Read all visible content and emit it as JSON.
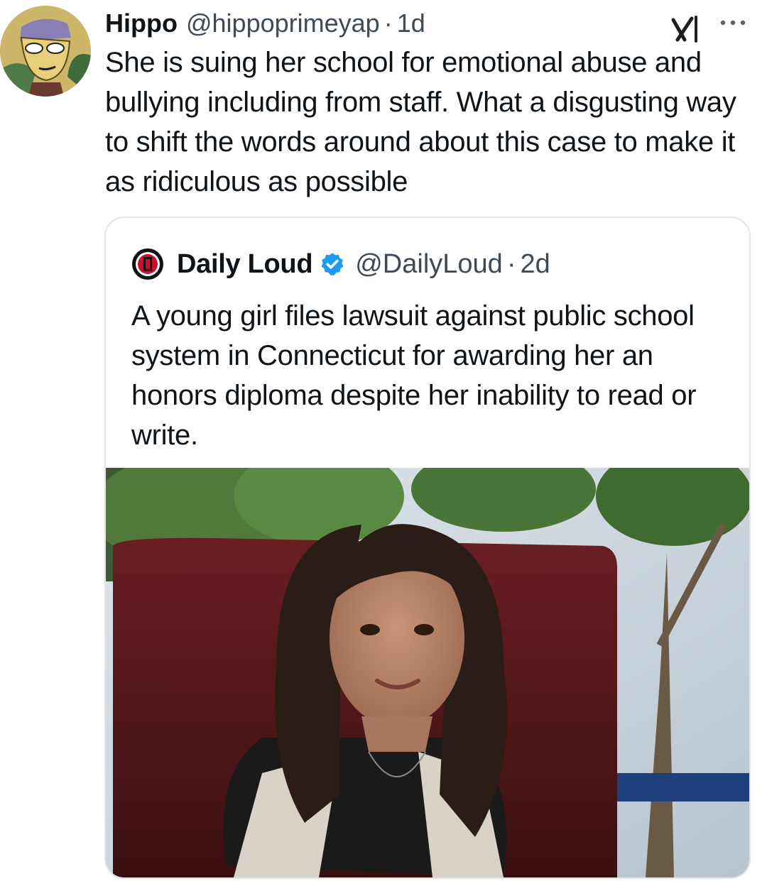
{
  "tweet": {
    "author_name": "Hippo",
    "author_handle": "@hippoprimeyap",
    "separator": "·",
    "time": "1d",
    "avatar_icon": "cartoon-avatar",
    "text": "She is suing her school for emotional abuse and bullying including from staff. What a disgusting way to shift the words around about this case to make it as ridiculous as possible"
  },
  "actions": {
    "grok_icon": "grok-icon",
    "more_icon": "more-icon"
  },
  "quote": {
    "author_name": "Daily Loud",
    "author_handle": "@DailyLoud",
    "separator": "·",
    "time": "2d",
    "verified": true,
    "verified_color": "#1d9bf0",
    "logo_icon": "daily-loud-logo",
    "text": "A young girl files lawsuit against public school system in Connecticut for awarding her an honors diploma despite her inability to read or write.",
    "media": "photo-young-woman-interview"
  }
}
